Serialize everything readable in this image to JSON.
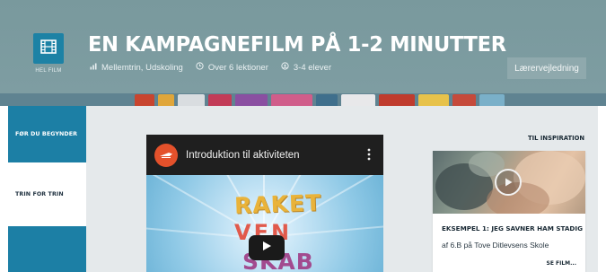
{
  "header": {
    "title": "EN KAMPAGNEFILM PÅ 1-2 MINUTTER",
    "logo_caption": "HEL FILM",
    "meta": {
      "levels": "Mellemtrin, Udskoling",
      "lessons": "Over 6 lektioner",
      "students": "3-4 elever"
    },
    "guide_button": "Lærervejledning"
  },
  "sidebar": {
    "items": [
      {
        "label": "FØR DU BEGYNDER"
      },
      {
        "label": "TRIN FOR TRIN"
      }
    ]
  },
  "video": {
    "title": "Introduktion til aktiviteten",
    "art_words": [
      "RAKET",
      "VEN",
      "SKAB"
    ]
  },
  "inspiration": {
    "label": "TIL INSPIRATION",
    "card": {
      "title": "EKSEMPEL 1: JEG SAVNER HAM STADIG",
      "subtitle": "af 6.B på Tove Ditlevsens Skole",
      "more": "SE FILM..."
    }
  },
  "colors": {
    "header_bg": "#7e9da2",
    "accent_blue": "#1c7fa5",
    "guide_button_bg": "#8fa9ad",
    "content_bg": "#e5e9eb",
    "youtube_avatar": "#e4512b"
  },
  "icons": {
    "logo": "film-icon",
    "levels": "bar-chart-icon",
    "lessons": "clock-icon",
    "students": "group-icon",
    "video_menu": "more-vertical-icon",
    "video_play": "play-icon",
    "card_play": "play-circle-icon"
  }
}
